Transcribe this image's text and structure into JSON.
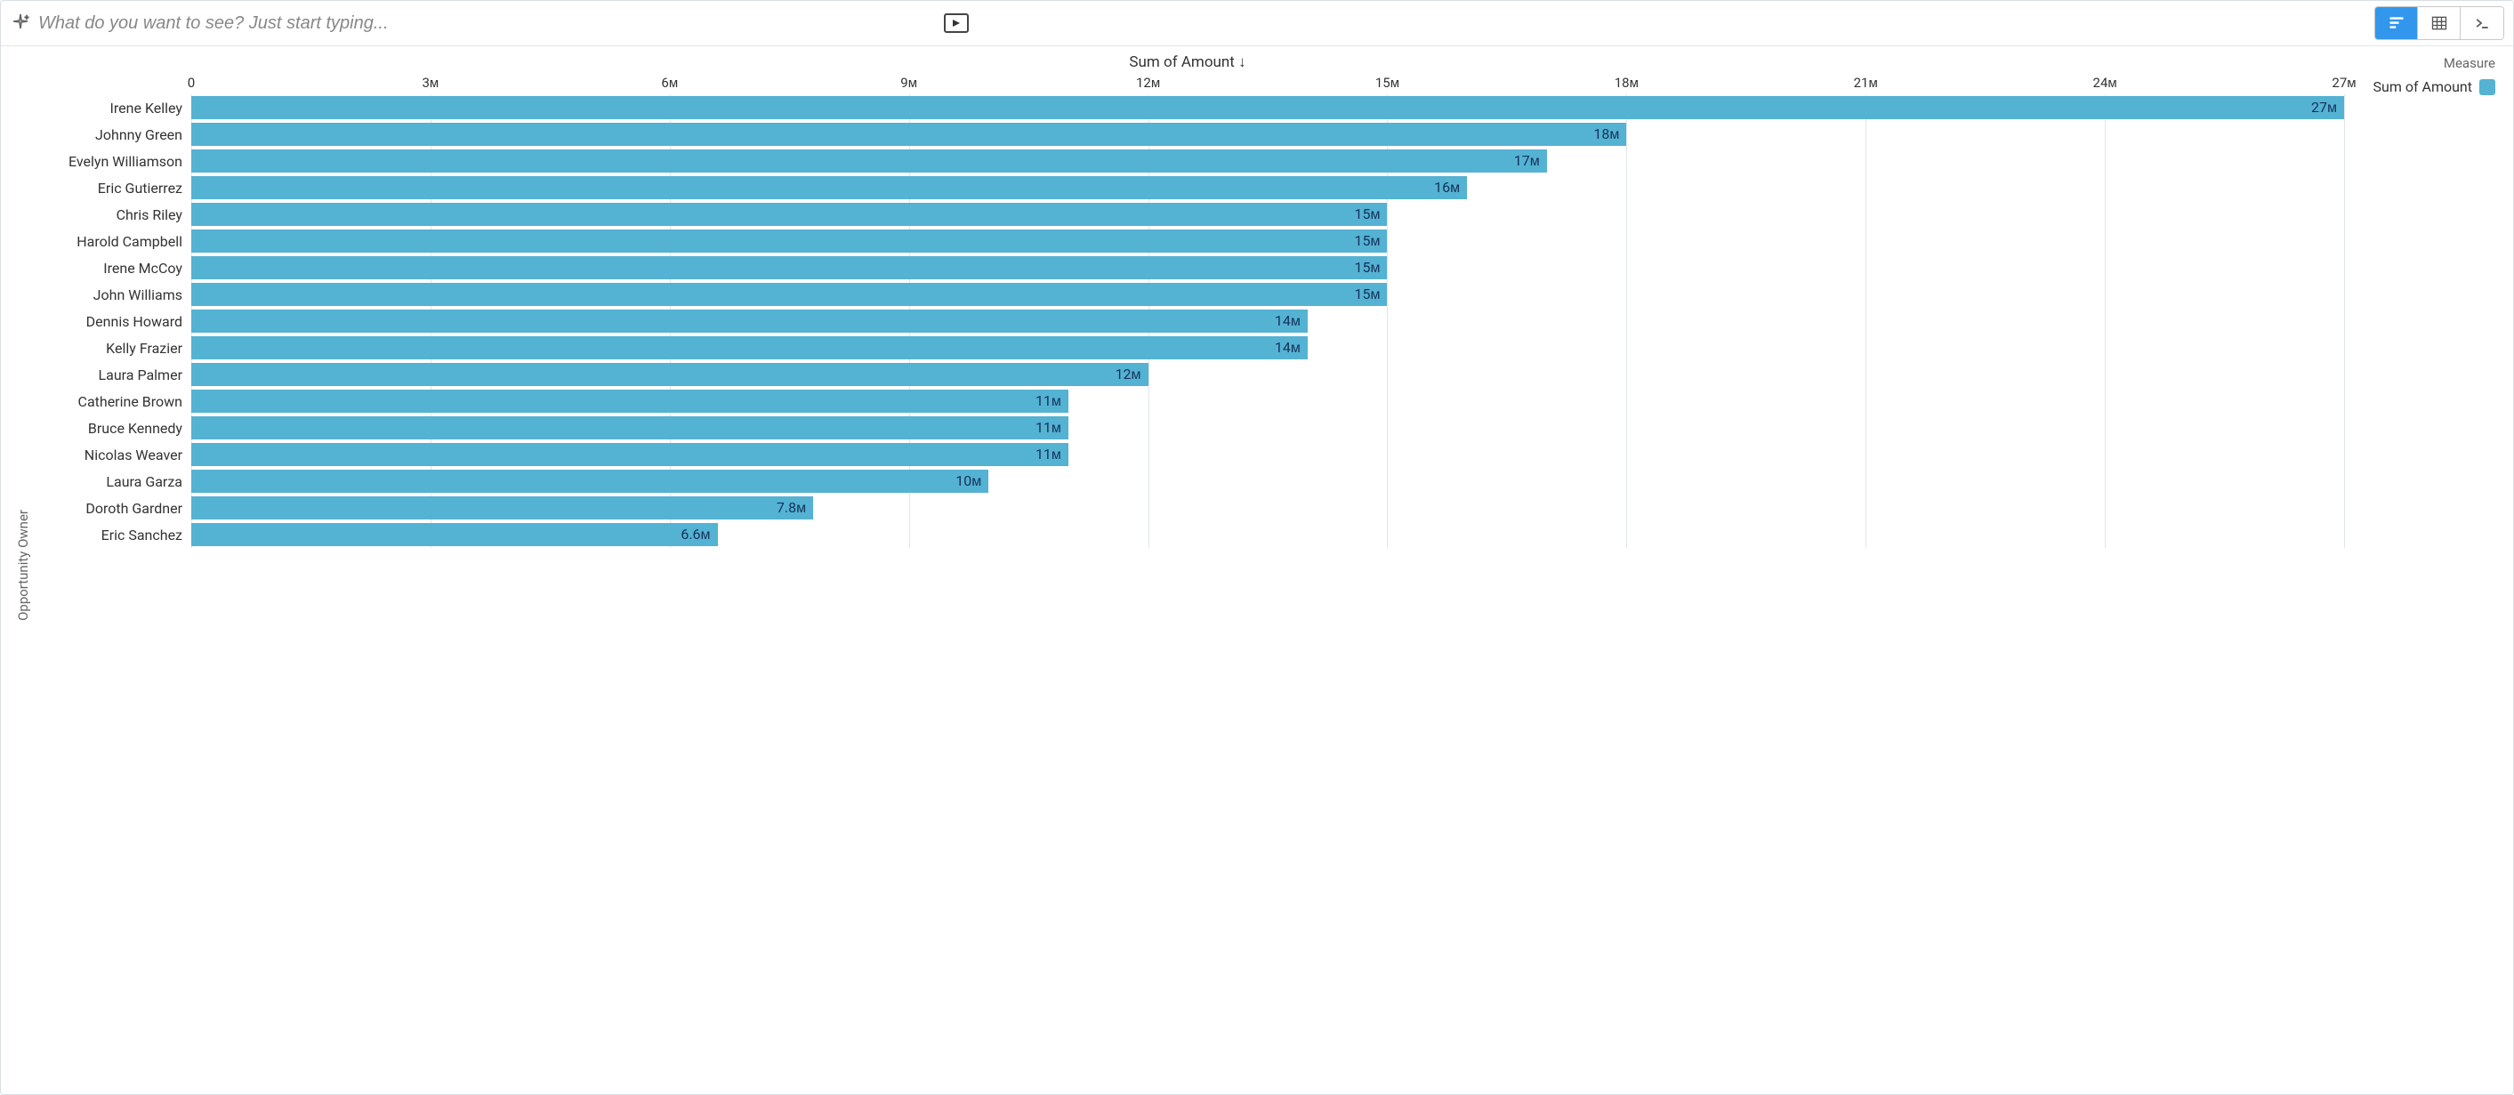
{
  "topbar": {
    "query_placeholder": "What do you want to see? Just start typing..."
  },
  "view_toggle": {
    "chart_mode": "chart",
    "table_mode": "table",
    "saql_mode": "saql"
  },
  "legend": {
    "title": "Measure",
    "item": "Sum of Amount",
    "swatch_color": "#54b2d3"
  },
  "chart_data": {
    "type": "bar",
    "orientation": "horizontal",
    "title": "Sum of Amount ↓",
    "ylabel": "Opportunity Owner",
    "xlabel": "",
    "x_ticks": [
      "0",
      "3ᴍ",
      "6ᴍ",
      "9ᴍ",
      "12ᴍ",
      "15ᴍ",
      "18ᴍ",
      "21ᴍ",
      "24ᴍ",
      "27ᴍ"
    ],
    "x_tick_values": [
      0,
      3,
      6,
      9,
      12,
      15,
      18,
      21,
      24,
      27
    ],
    "xlim": [
      0,
      27
    ],
    "categories": [
      "Irene Kelley",
      "Johnny Green",
      "Evelyn Williamson",
      "Eric Gutierrez",
      "Chris Riley",
      "Harold Campbell",
      "Irene McCoy",
      "John Williams",
      "Dennis Howard",
      "Kelly Frazier",
      "Laura Palmer",
      "Catherine Brown",
      "Bruce Kennedy",
      "Nicolas Weaver",
      "Laura Garza",
      "Doroth Gardner",
      "Eric Sanchez"
    ],
    "values": [
      27,
      18,
      17,
      16,
      15,
      15,
      15,
      15,
      14,
      14,
      12,
      11,
      11,
      11,
      10,
      7.8,
      6.6
    ],
    "value_labels": [
      "27ᴍ",
      "18ᴍ",
      "17ᴍ",
      "16ᴍ",
      "15ᴍ",
      "15ᴍ",
      "15ᴍ",
      "15ᴍ",
      "14ᴍ",
      "14ᴍ",
      "12ᴍ",
      "11ᴍ",
      "11ᴍ",
      "11ᴍ",
      "10ᴍ",
      "7.8ᴍ",
      "6.6ᴍ"
    ],
    "bar_color": "#54b2d3",
    "units": "M"
  }
}
